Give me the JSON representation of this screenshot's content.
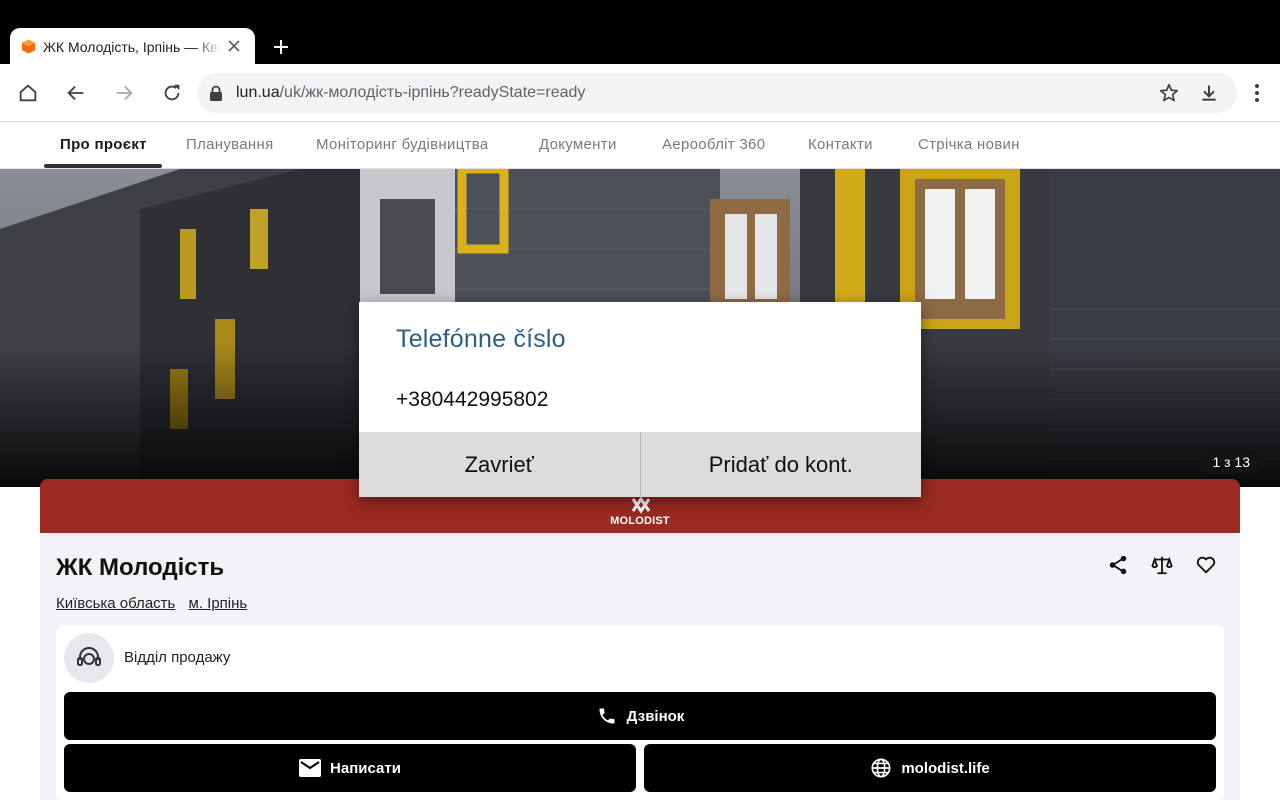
{
  "browser": {
    "tab_title": "ЖК Молодість, Ірпінь — Квартири в новобудові",
    "url_host": "lun.ua",
    "url_path": "/uk/жк-молодість-ірпінь?readyState=ready"
  },
  "nav": {
    "items": [
      "Про проєкт",
      "Планування",
      "Моніторинг будівництва",
      "Документи",
      "Аерообліт 360",
      "Контакти",
      "Стрічка новин"
    ]
  },
  "gallery": {
    "counter": "1 з 13"
  },
  "brand": {
    "logo_text": "MOLODIST"
  },
  "project": {
    "title": "ЖК Молодість",
    "region": "Київська область",
    "city": "м. Ірпінь"
  },
  "sales": {
    "label": "Відділ продажу",
    "call_label": "Дзвінок",
    "write_label": "Написати",
    "site_label": "molodist.life"
  },
  "dialog": {
    "title": "Telefónne číslo",
    "phone": "+380442995802",
    "close_label": "Zavrieť",
    "add_label": "Pridať do kont."
  },
  "colors": {
    "brand": "#9a2a22",
    "dialog_title": "#2d5f86",
    "action_button": "#000000"
  }
}
